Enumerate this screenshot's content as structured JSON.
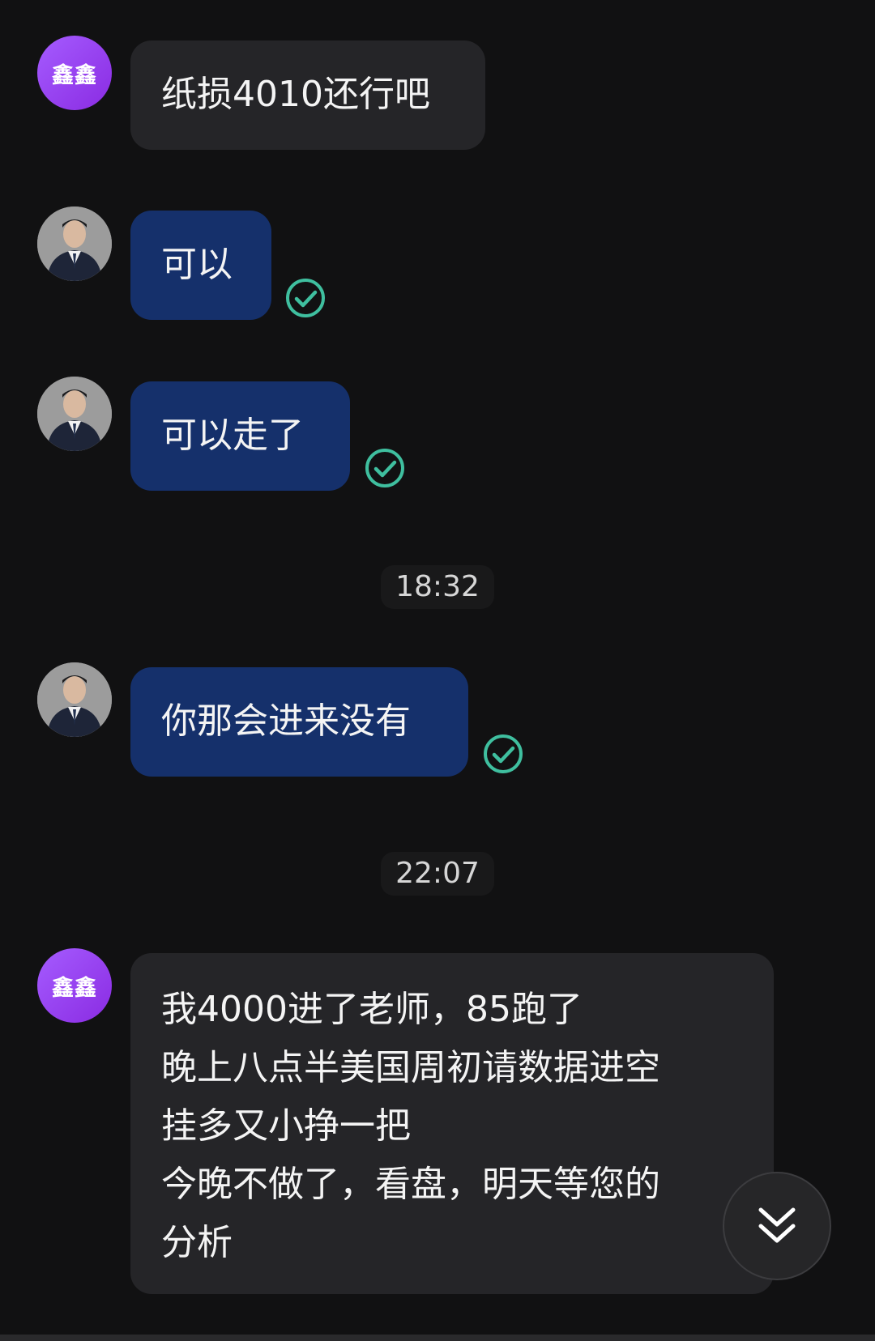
{
  "messages": [
    {
      "sender_avatar_text": "鑫鑫",
      "text": "纸损4010还行吧"
    },
    {
      "text": "可以"
    },
    {
      "text": "可以走了"
    },
    {
      "time": "18:32"
    },
    {
      "text": "你那会进来没有"
    },
    {
      "time": "22:07"
    },
    {
      "sender_avatar_text": "鑫鑫",
      "lines": [
        "我4000进了老师，85跑了",
        "晚上八点半美国周初请数据进空",
        "挂多又小挣一把",
        "今晚不做了，看盘，明天等您的",
        "分析"
      ]
    }
  ],
  "icons": {
    "read_receipt": "check-circle-icon",
    "scroll_down": "double-chevron-down-icon"
  },
  "colors": {
    "background": "#111112",
    "incoming_bubble": "#252528",
    "outgoing_bubble": "#15306b",
    "read_check": "#3fbf9f",
    "avatar_purple": "#9b45ff"
  }
}
